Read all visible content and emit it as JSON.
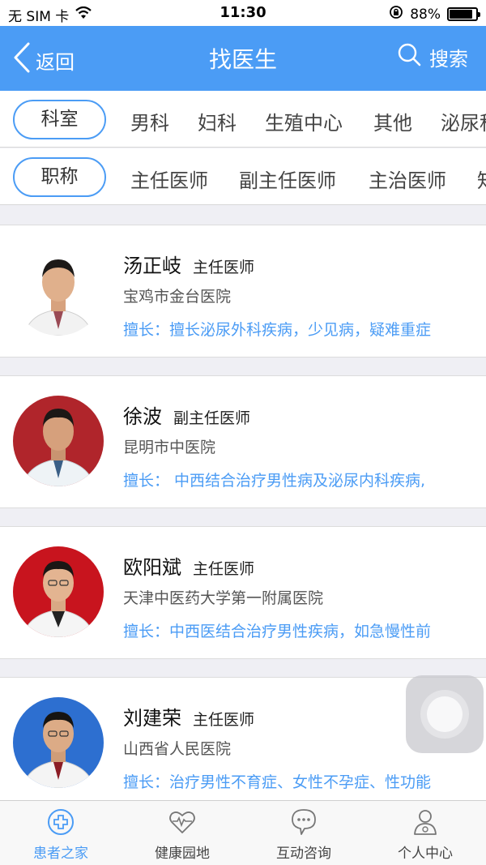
{
  "status_bar": {
    "carrier": "无 SIM 卡",
    "time": "11:30",
    "battery_percent": "88%",
    "battery_level": 0.88
  },
  "nav": {
    "back_label": "返回",
    "title": "找医生",
    "search_label": "搜索"
  },
  "filters": {
    "department": {
      "label": "科室",
      "options": [
        "男科",
        "妇科",
        "生殖中心",
        "其他",
        "泌尿科"
      ]
    },
    "title": {
      "label": "职称",
      "options": [
        "主任医师",
        "副主任医师",
        "主治医师",
        "知名专家"
      ]
    }
  },
  "doctors": [
    {
      "name": "汤正岐",
      "title": "主任医师",
      "hospital": "宝鸡市金台医院",
      "skill": "擅长：擅长泌尿外科疾病，少见病，疑难重症",
      "avatar_bg": "#ffffff"
    },
    {
      "name": "徐波",
      "title": "副主任医师",
      "hospital": "昆明市中医院",
      "skill": "擅长： 中西结合治疗男性病及泌尿内科疾病,",
      "avatar_bg": "#b0252b"
    },
    {
      "name": "欧阳斌",
      "title": "主任医师",
      "hospital": "天津中医药大学第一附属医院",
      "skill": "擅长：中西医结合治疗男性疾病，如急慢性前",
      "avatar_bg": "#c8141e"
    },
    {
      "name": "刘建荣",
      "title": "主任医师",
      "hospital": "山西省人民医院",
      "skill": "擅长：治疗男性不育症、女性不孕症、性功能",
      "avatar_bg": "#2d6fd0"
    }
  ],
  "tabbar": [
    {
      "label": "患者之家",
      "icon": "medical-cross-icon",
      "active": true
    },
    {
      "label": "健康园地",
      "icon": "heart-pulse-icon",
      "active": false
    },
    {
      "label": "互动咨询",
      "icon": "chat-bubble-icon",
      "active": false
    },
    {
      "label": "个人中心",
      "icon": "person-icon",
      "active": false
    }
  ],
  "colors": {
    "accent": "#4b9cf5",
    "background": "#efeff4"
  }
}
